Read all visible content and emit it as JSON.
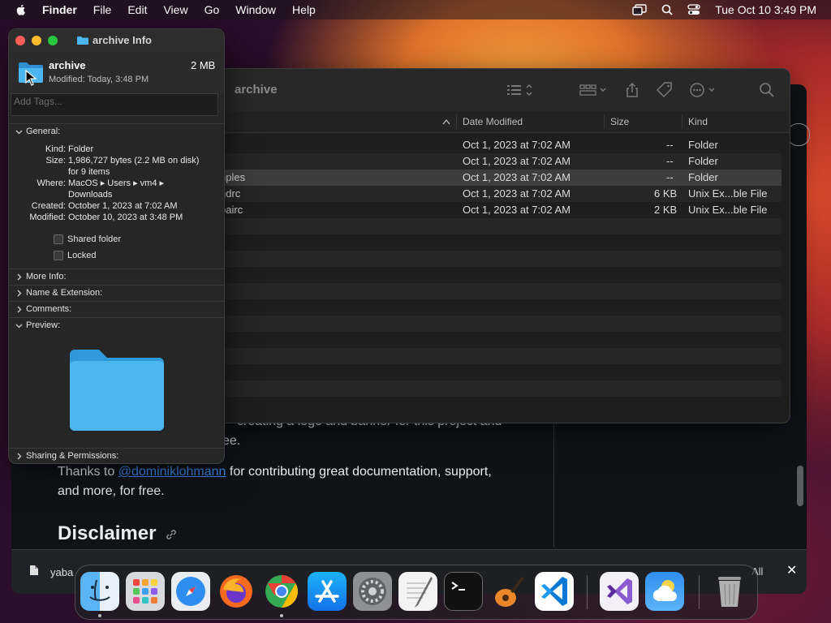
{
  "menubar": {
    "items": [
      "Finder",
      "File",
      "Edit",
      "View",
      "Go",
      "Window",
      "Help"
    ],
    "datetime": "Tue Oct 10  3:49 PM"
  },
  "browser": {
    "line1": "creating a logo and banner for this project and",
    "line2": "ee.",
    "thanks_prefix": "Thanks to ",
    "thanks_link": "@dominiklohmann",
    "thanks_suffix": " for contributing great documentation, support,",
    "thanks_line2": "and more, for free.",
    "heading": "Disclaimer"
  },
  "download_bar": {
    "file": "yaba",
    "show_all": "All"
  },
  "finder": {
    "title": "archive",
    "columns": {
      "name": "e",
      "date": "Date Modified",
      "size": "Size",
      "kind": "Kind"
    },
    "rows": [
      {
        "name": "",
        "date": "Oct 1, 2023 at 7:02 AM",
        "size": "--",
        "kind": "Folder"
      },
      {
        "name": "",
        "date": "Oct 1, 2023 at 7:02 AM",
        "size": "--",
        "kind": "Folder"
      },
      {
        "name": "nples",
        "date": "Oct 1, 2023 at 7:02 AM",
        "size": "--",
        "kind": "Folder"
      },
      {
        "name": "hdrc",
        "date": "Oct 1, 2023 at 7:02 AM",
        "size": "6 KB",
        "kind": "Unix Ex...ble File"
      },
      {
        "name": "bairc",
        "date": "Oct 1, 2023 at 7:02 AM",
        "size": "2 KB",
        "kind": "Unix Ex...ble File"
      }
    ],
    "selected_row": 2
  },
  "info": {
    "window_title": "archive Info",
    "name": "archive",
    "size": "2 MB",
    "modified": "Modified: Today, 3:48 PM",
    "tags_placeholder": "Add Tags...",
    "general_label": "General:",
    "general": [
      {
        "k": "Kind:",
        "v": "Folder"
      },
      {
        "k": "Size:",
        "v": "1,986,727 bytes (2.2 MB on disk)"
      },
      {
        "k": "",
        "v": "for 9 items"
      },
      {
        "k": "Where:",
        "v": "MacOS ▸ Users ▸ vm4 ▸"
      },
      {
        "k": "",
        "v": "Downloads"
      },
      {
        "k": "Created:",
        "v": "October 1, 2023 at 7:02 AM"
      },
      {
        "k": "Modified:",
        "v": "October 10, 2023 at 3:48 PM"
      }
    ],
    "shared_folder": "Shared folder",
    "locked": "Locked",
    "more_info": "More Info:",
    "name_ext": "Name & Extension:",
    "comments": "Comments:",
    "preview": "Preview:",
    "sharing": "Sharing & Permissions:"
  },
  "colors": {
    "folder_blue": "#4cb6f0",
    "link": "#4493f8",
    "close_red": "#ff5f57",
    "minimize_yellow": "#febc2e",
    "zoom_green": "#28c840"
  },
  "dock": {
    "apps": [
      "finder",
      "launchpad",
      "safari",
      "firefox",
      "chrome",
      "app-store",
      "system-settings",
      "textedit",
      "terminal",
      "garageband",
      "vscode",
      "visual-studio",
      "weather",
      "trash"
    ]
  }
}
